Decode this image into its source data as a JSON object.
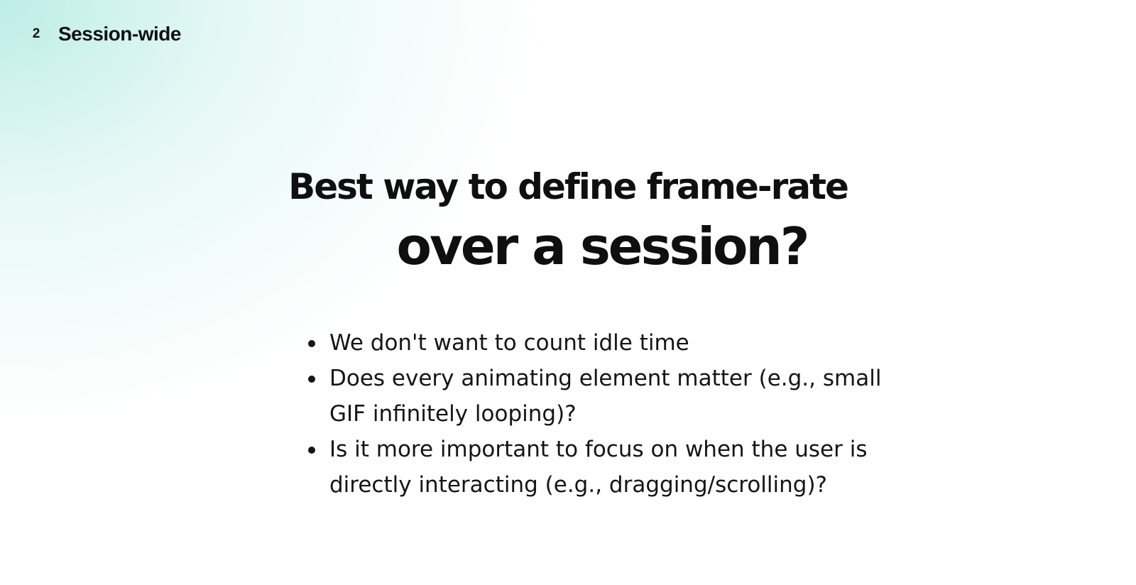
{
  "slide": {
    "section_number": "2",
    "section_label": "Session-wide",
    "title_line1": "Best way to define frame-rate",
    "title_line2": "over a session?",
    "bullets": [
      "We don't want to count idle time",
      "Does every animating element matter (e.g., small GIF infinitely looping)?",
      "Is it more important to focus on when the user is directly interacting (e.g., dragging/scrolling)?"
    ]
  },
  "colors": {
    "accent_badge": "#c7efe9",
    "background_glow": "#baece6",
    "text": "#111111"
  }
}
